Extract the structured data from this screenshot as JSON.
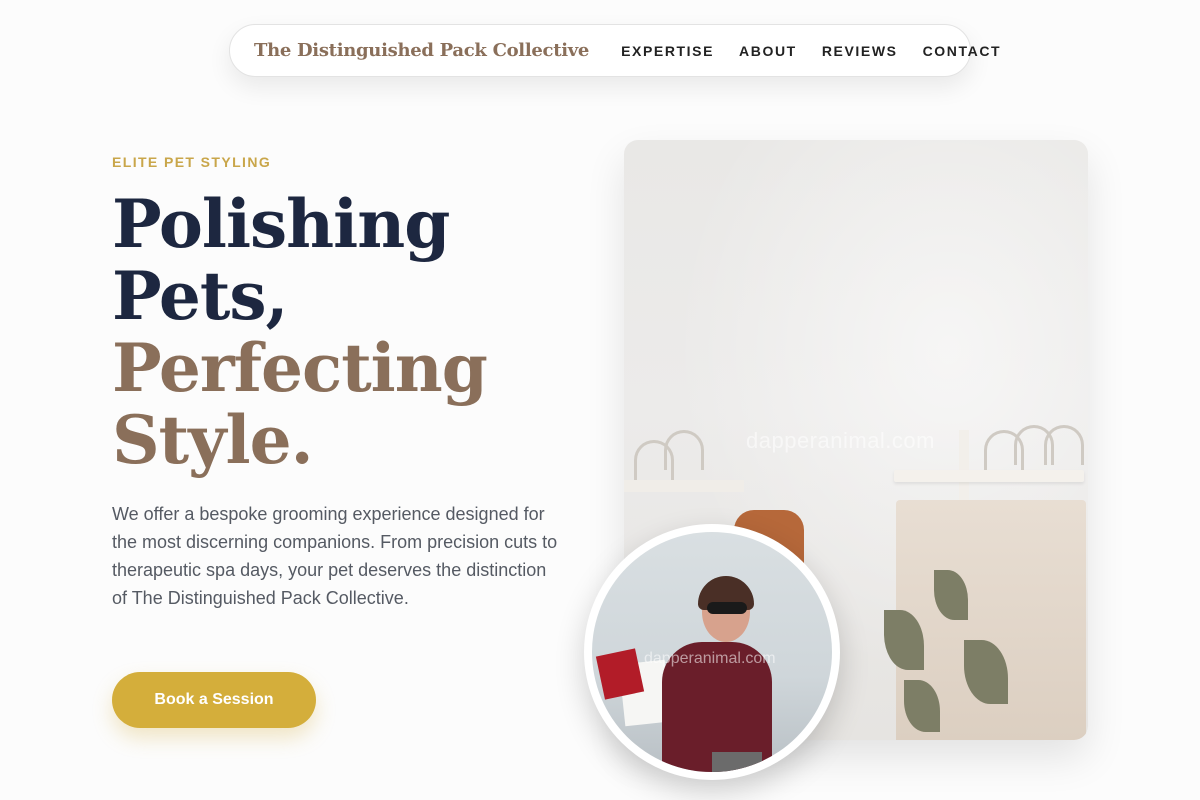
{
  "nav": {
    "brand": "The Distinguished Pack Collective",
    "links": [
      {
        "label": "EXPERTISE"
      },
      {
        "label": "ABOUT"
      },
      {
        "label": "REVIEWS"
      },
      {
        "label": "CONTACT"
      }
    ]
  },
  "hero": {
    "eyebrow": "ELITE PET STYLING",
    "headline": {
      "line1": "Polishing",
      "line2": "Pets,",
      "line3": "Perfecting",
      "line4": "Style."
    },
    "lead": "We offer a bespoke grooming experience designed for the most discerning companions. From precision cuts to therapeutic spa days, your pet deserves the distinction of The Distinguished Pack Collective.",
    "cta_label": "Book a Session",
    "image_watermark": "dapperanimal.com",
    "circle_watermark": "dapperanimal.com"
  },
  "colors": {
    "accent_gold": "#d4ae3b",
    "brand_brown": "#8a6f5a",
    "heading_navy": "#1d2740"
  },
  "icons": []
}
